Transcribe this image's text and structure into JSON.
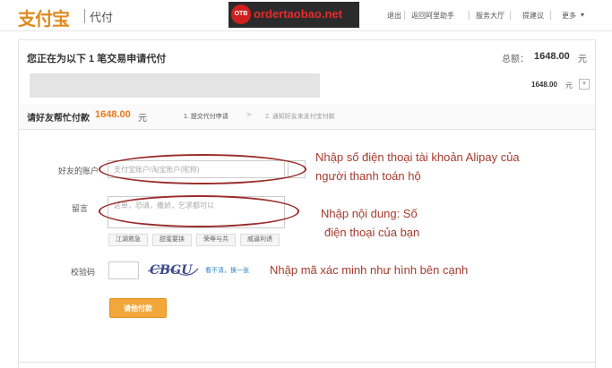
{
  "header": {
    "logo_text": "支付宝",
    "logo_sub": "代付",
    "watermark_badge": "OTB",
    "watermark_text": "ordertaobao.net",
    "nav": [
      "退出",
      "返回阿里助手",
      "服务大厅",
      "提建议",
      "更多"
    ]
  },
  "summary": {
    "title": "您正在为以下 1 笔交易申请代付",
    "total_label": "总额：",
    "total_value": "1648.00",
    "total_unit": "元",
    "row_value": "1648.00",
    "row_unit": "元",
    "row_toggle": "▾"
  },
  "request": {
    "label": "请好友帮忙付款",
    "amount": "1648.00",
    "unit": "元",
    "step1": "1. 提交代付申请",
    "step_arrow": ">",
    "step2": "2. 通知好友来支付宝付款"
  },
  "form": {
    "account_label": "好友的账户",
    "account_placeholder": "支付宝账户/淘宝账户(昵称)",
    "message_label": "留言",
    "message_placeholder": "这单，恐请，撒娇，乞求都可以",
    "chips": [
      "江湖救急",
      "甜蜜要挟",
      "荣辱与共",
      "威逼利诱"
    ],
    "captcha_label": "校验码",
    "captcha_text": "CBGU",
    "captcha_refresh": "看不清，换一张",
    "submit_label": "请他付款"
  },
  "annotations": {
    "account": [
      "Nhập số điện thoại tài khoản Alipay của",
      "người thanh toán hộ"
    ],
    "message": [
      "Nhập nội dung: Số",
      "điện thoại của bạn"
    ],
    "captcha": [
      "Nhập mã xác minh như hình bên cạnh"
    ]
  },
  "colors": {
    "accent_orange": "#e97a1c",
    "annotation_red": "#a33b2d",
    "button": "#f2a73b"
  }
}
